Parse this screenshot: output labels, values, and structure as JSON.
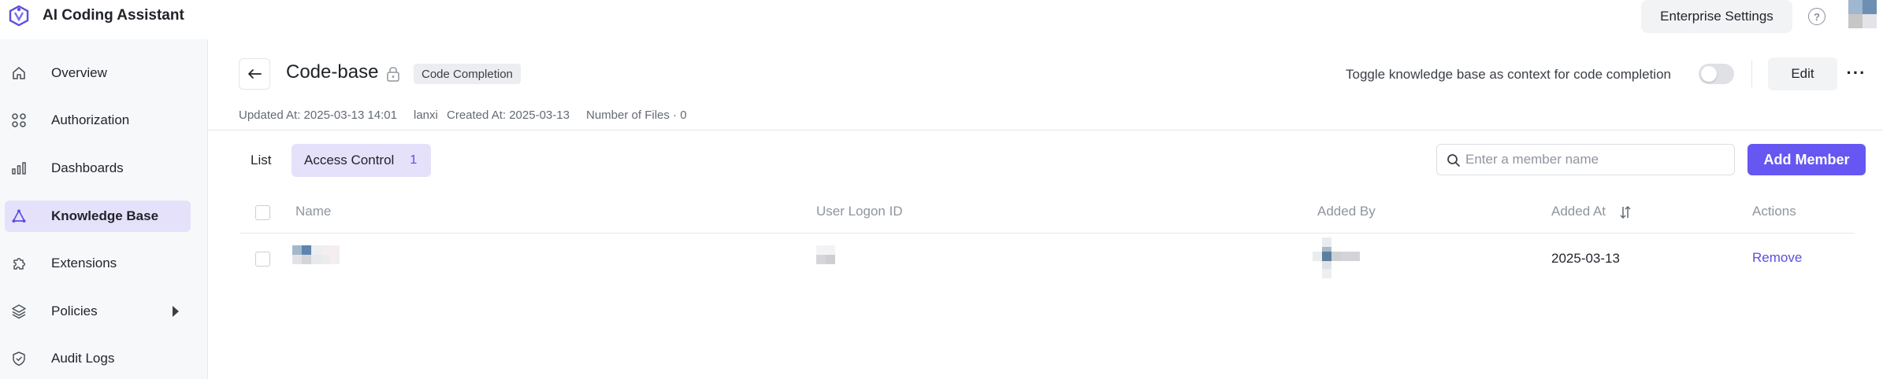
{
  "app": {
    "title": "AI Coding Assistant"
  },
  "topbar": {
    "enterprise_settings": "Enterprise Settings",
    "help_icon": "?"
  },
  "sidebar": {
    "items": [
      {
        "label": "Overview",
        "icon": "home-icon"
      },
      {
        "label": "Authorization",
        "icon": "grid-icon"
      },
      {
        "label": "Dashboards",
        "icon": "bar-chart-icon"
      },
      {
        "label": "Knowledge Base",
        "icon": "knowledge-icon",
        "active": true
      },
      {
        "label": "Extensions",
        "icon": "puzzle-icon"
      },
      {
        "label": "Policies",
        "icon": "layers-icon"
      },
      {
        "label": "Audit Logs",
        "icon": "shield-icon"
      }
    ]
  },
  "header": {
    "title": "Code-base",
    "tag": "Code Completion",
    "toggle_label": "Toggle knowledge base as context for code completion",
    "toggle_on": false,
    "edit": "Edit",
    "more": "···"
  },
  "meta": {
    "updated": "Updated At: 2025-03-13 14:01",
    "user": "lanxi",
    "created": "Created At: 2025-03-13",
    "files": "Number of Files · 0"
  },
  "tabs": {
    "list": "List",
    "access_control": "Access Control",
    "access_count": "1"
  },
  "search": {
    "placeholder": "Enter a member name"
  },
  "add_member": "Add Member",
  "table": {
    "columns": [
      "Name",
      "User Logon ID",
      "Added By",
      "Added At",
      "Actions"
    ],
    "rows": [
      {
        "added_at": "2025-03-13",
        "action": "Remove"
      }
    ]
  },
  "colors": {
    "accent": "#6657f2",
    "active_bg": "#e5e1fa",
    "link": "#5b4fe0"
  }
}
